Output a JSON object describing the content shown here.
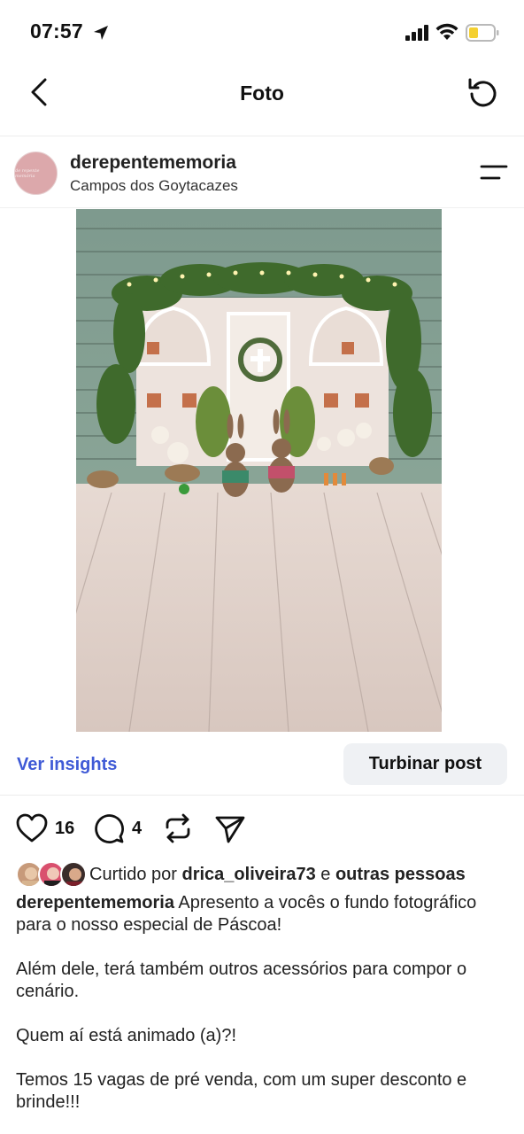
{
  "status_bar": {
    "time": "07:57"
  },
  "nav": {
    "title": "Foto"
  },
  "post": {
    "username": "derepentememoria",
    "location": "Campos dos Goytacazes",
    "avatar_text": "de repente memória"
  },
  "insights": {
    "link": "Ver insights",
    "boost_button": "Turbinar post"
  },
  "actions": {
    "likes_count": "16",
    "comments_count": "4"
  },
  "liked_by": {
    "prefix": "Curtido por",
    "user": "drica_oliveira73",
    "conj": "e",
    "others": "outras pessoas"
  },
  "caption": {
    "username": "derepentememoria",
    "line1": "Apresento a vocês o fundo fotográfico para o nosso especial de Páscoa!",
    "para2": "Além dele, terá também outros acessórios para compor o cenário.",
    "para3": "Quem aí está animado (a)?!",
    "para4": "Temos 15 vagas de pré venda, com um super desconto e brinde!!!"
  },
  "colors": {
    "link_blue": "#3f5ad6",
    "avatar_pink": "#dca8ab",
    "boost_bg": "#eff1f4"
  },
  "icons": [
    "location-arrow-icon",
    "signal-icon",
    "wifi-icon",
    "battery-icon",
    "back-chevron-icon",
    "refresh-icon",
    "options-icon",
    "heart-icon",
    "comment-icon",
    "repost-icon",
    "share-icon"
  ]
}
